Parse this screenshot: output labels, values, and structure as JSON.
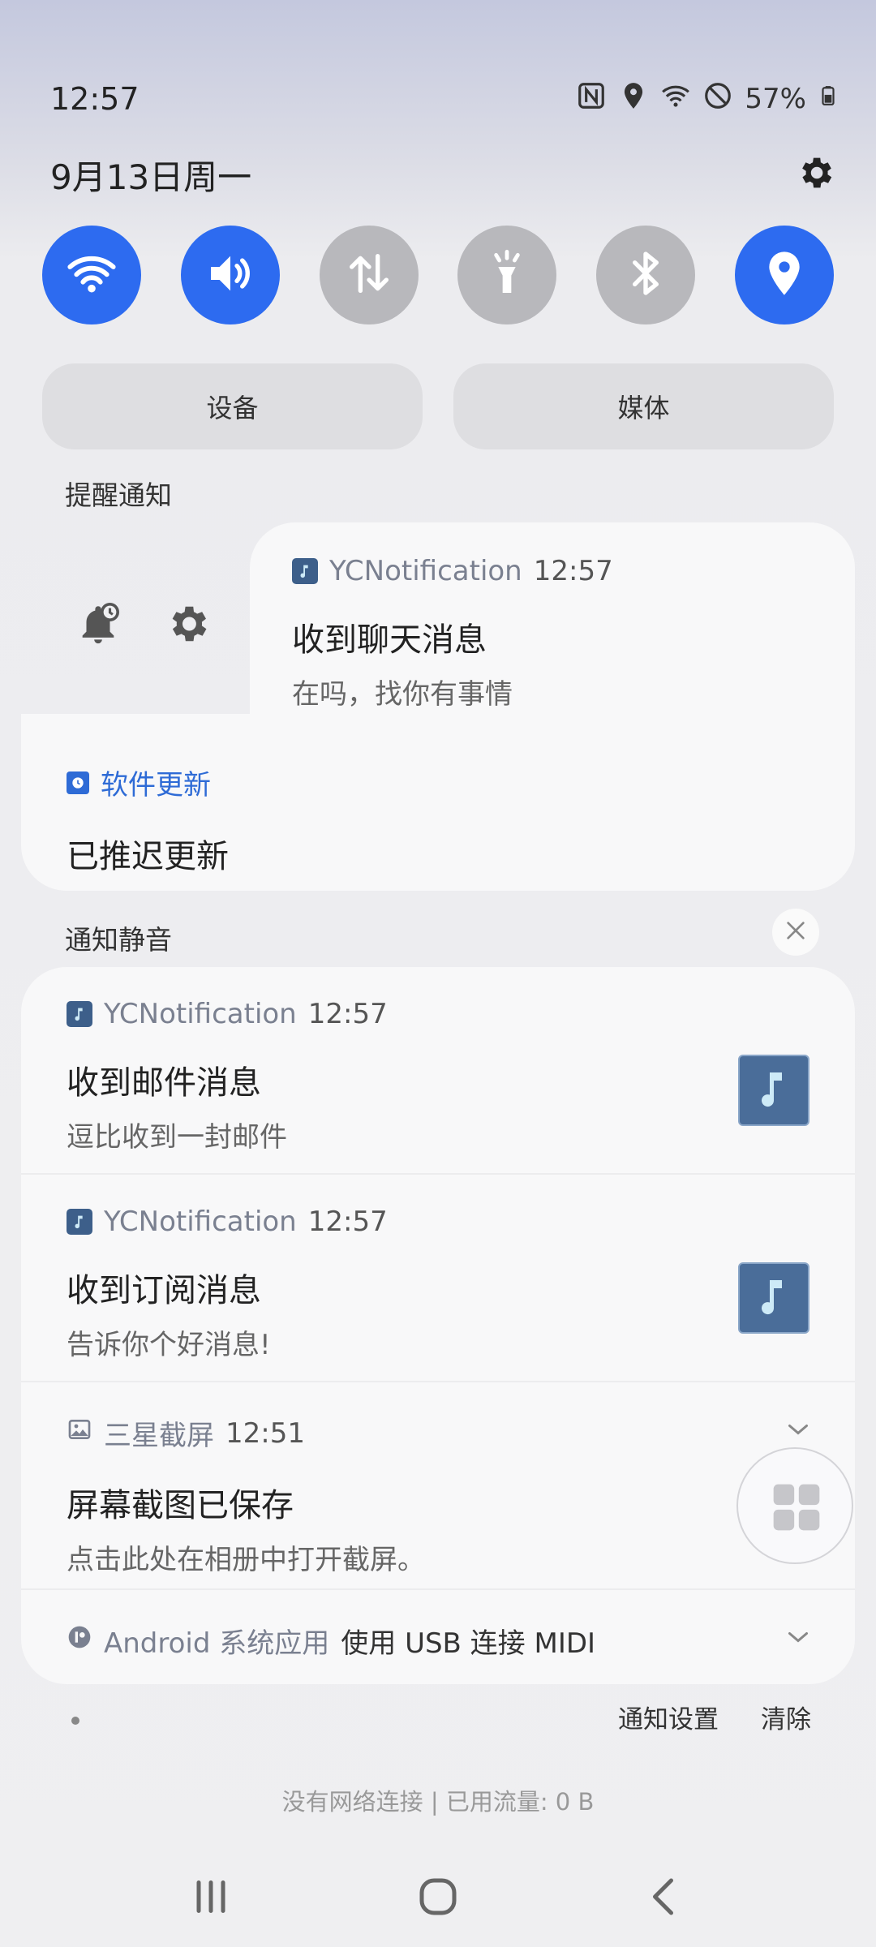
{
  "status_bar": {
    "time": "12:57",
    "battery": "57%",
    "icons": [
      "nfc-icon",
      "location-icon",
      "wifi-icon",
      "do-not-disturb-icon",
      "battery-icon"
    ]
  },
  "header": {
    "date": "9月13日周一"
  },
  "quick_toggles": [
    {
      "name": "wifi",
      "icon": "wifi-icon",
      "state": "on"
    },
    {
      "name": "sound",
      "icon": "volume-icon",
      "state": "on"
    },
    {
      "name": "mobile-data",
      "icon": "data-transfer-icon",
      "state": "off"
    },
    {
      "name": "flashlight",
      "icon": "flashlight-icon",
      "state": "off"
    },
    {
      "name": "bluetooth",
      "icon": "bluetooth-icon",
      "state": "off"
    },
    {
      "name": "location",
      "icon": "location-icon",
      "state": "on"
    }
  ],
  "pills": {
    "devices": "设备",
    "media": "媒体"
  },
  "alerting_section": {
    "label": "提醒通知",
    "notifications": [
      {
        "app": "YCNotification",
        "time": "12:57",
        "title": "收到聊天消息",
        "body": "在吗，找你有事情"
      },
      {
        "app": "软件更新",
        "title": "已推迟更新"
      }
    ]
  },
  "silent_section": {
    "label": "通知静音",
    "notifications": [
      {
        "app": "YCNotification",
        "time": "12:57",
        "title": "收到邮件消息",
        "body": "逗比收到一封邮件"
      },
      {
        "app": "YCNotification",
        "time": "12:57",
        "title": "收到订阅消息",
        "body": "告诉你个好消息!"
      },
      {
        "app": "三星截屏",
        "time": "12:51",
        "title": "屏幕截图已保存",
        "body": "点击此处在相册中打开截屏。"
      },
      {
        "app": "Android 系统应用",
        "title": "使用 USB 连接 MIDI"
      }
    ]
  },
  "footer": {
    "notification_settings": "通知设置",
    "clear": "清除",
    "network_status": "没有网络连接 | 已用流量: 0 B"
  },
  "colors": {
    "accent_blue": "#2d6bf0",
    "toggle_off": "#b8b8bc",
    "link_blue": "#2e6bd6"
  }
}
